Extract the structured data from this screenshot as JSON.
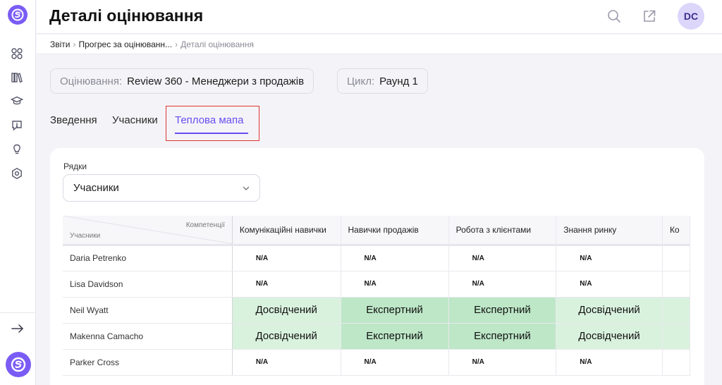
{
  "header": {
    "title": "Деталі оцінювання",
    "avatar_initials": "DC"
  },
  "breadcrumb": {
    "items": [
      "Звіти",
      "Прогрес за оцінюванн...",
      "Деталі оцінювання"
    ]
  },
  "filters": {
    "assessment": {
      "label": "Оцінювання:",
      "value": "Review 360 - Менеджери з продажів"
    },
    "cycle": {
      "label": "Цикл:",
      "value": "Раунд 1"
    }
  },
  "tabs": [
    {
      "label": "Зведення"
    },
    {
      "label": "Учасники"
    },
    {
      "label": "Теплова мапа",
      "active": true
    }
  ],
  "rows_select": {
    "label": "Рядки",
    "value": "Учасники"
  },
  "heatmap": {
    "corner_top": "Компетенції",
    "corner_bottom": "Учасники",
    "columns": [
      "Комунікаційні навички",
      "Навички продажів",
      "Робота з клієнтами",
      "Знання ринку",
      "Ко"
    ],
    "rows": [
      {
        "name": "Daria Petrenko",
        "cells": [
          "N/A",
          "N/A",
          "N/A",
          "N/A",
          ""
        ]
      },
      {
        "name": "Lisa Davidson",
        "cells": [
          "N/A",
          "N/A",
          "N/A",
          "N/A",
          ""
        ]
      },
      {
        "name": "Neil Wyatt",
        "cells": [
          "Досвідчений",
          "Експертний",
          "Експертний",
          "Досвідчений",
          ""
        ]
      },
      {
        "name": "Makenna Camacho",
        "cells": [
          "Досвідчений",
          "Експертний",
          "Експертний",
          "Досвідчений",
          ""
        ]
      },
      {
        "name": "Parker Cross",
        "cells": [
          "N/A",
          "N/A",
          "N/A",
          "N/A",
          ""
        ]
      }
    ],
    "level_colors": {
      "Експертний": "#bde7c7",
      "Досвідчений": "#d9f2de"
    }
  },
  "icons": {
    "sidebar": [
      "apps-icon",
      "library-icon",
      "graduation-cap-icon",
      "chat-question-icon",
      "lightbulb-icon",
      "settings-hex-icon"
    ],
    "header": [
      "search-icon",
      "external-link-icon"
    ]
  },
  "colors": {
    "accent": "#6a4cf0",
    "brand": "#7a5cf5",
    "highlight": "#e03333"
  }
}
